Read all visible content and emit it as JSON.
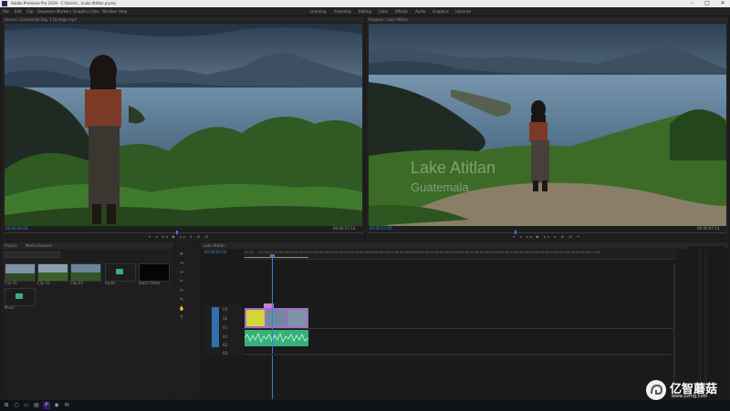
{
  "window": {
    "title": "Adobe Premiere Pro 2019 - C:\\Users\\...\\Lake Atitlan.prproj",
    "controls": [
      "–",
      "□",
      "✕"
    ]
  },
  "menu": {
    "items": [
      "File",
      "Edit",
      "Clip",
      "Sequence",
      "Markers",
      "Graphics",
      "View",
      "Window",
      "Help"
    ],
    "workspaces": [
      "Learning",
      "Assembly",
      "Editing",
      "Color",
      "Effects",
      "Audio",
      "Graphics",
      "Libraries"
    ]
  },
  "source_monitor": {
    "tab": "Source: Guatemala Day 1 Footage.mp4",
    "timecode_left": "00:00:00:00",
    "timecode_right": "00:00:17:14"
  },
  "program_monitor": {
    "tab": "Program: Lake Atitlan",
    "title_line1": "Lake Atitlan",
    "title_line2": "Guatemala",
    "timecode_left": "00:00:03:00",
    "timecode_right": "00:00:07:14"
  },
  "project": {
    "tabs": [
      "Project",
      "Media Browser"
    ],
    "search_placeholder": "",
    "items": [
      "Clip 01",
      "Clip 02",
      "Clip 03",
      "Audio",
      "Black Video",
      "Music"
    ]
  },
  "timeline": {
    "tab": "Lake Atitlan",
    "timecode": "00:00:03:00",
    "ruler": [
      "00:00",
      "00:00:01:00",
      "00:00:02:00",
      "00:00:03:00",
      "00:00:04:00",
      "00:00:05:00",
      "00:00:06:00",
      "00:00:07:00",
      "00:00:08:00",
      "00:00:09:00",
      "00:00:10:00",
      "00:00:11:00",
      "00:00:12:00",
      "00:00:13:00",
      "00:00:14:00",
      "00:00:15:00",
      "00:00:16:00",
      "00:00:17:00"
    ],
    "tracks": [
      "V3",
      "V2",
      "V1",
      "A1",
      "A2",
      "A3"
    ]
  },
  "taskbar": {
    "start_icon": "windows-icon",
    "search_icon": "search-icon"
  },
  "watermark": {
    "name": "亿智蘑菇",
    "url": "www.yzmg.com"
  },
  "colors": {
    "accent": "#2d8ceb",
    "clip_video": "#a56cc9",
    "clip_audio": "#37b07a",
    "playhead": "#3f7bd6"
  }
}
